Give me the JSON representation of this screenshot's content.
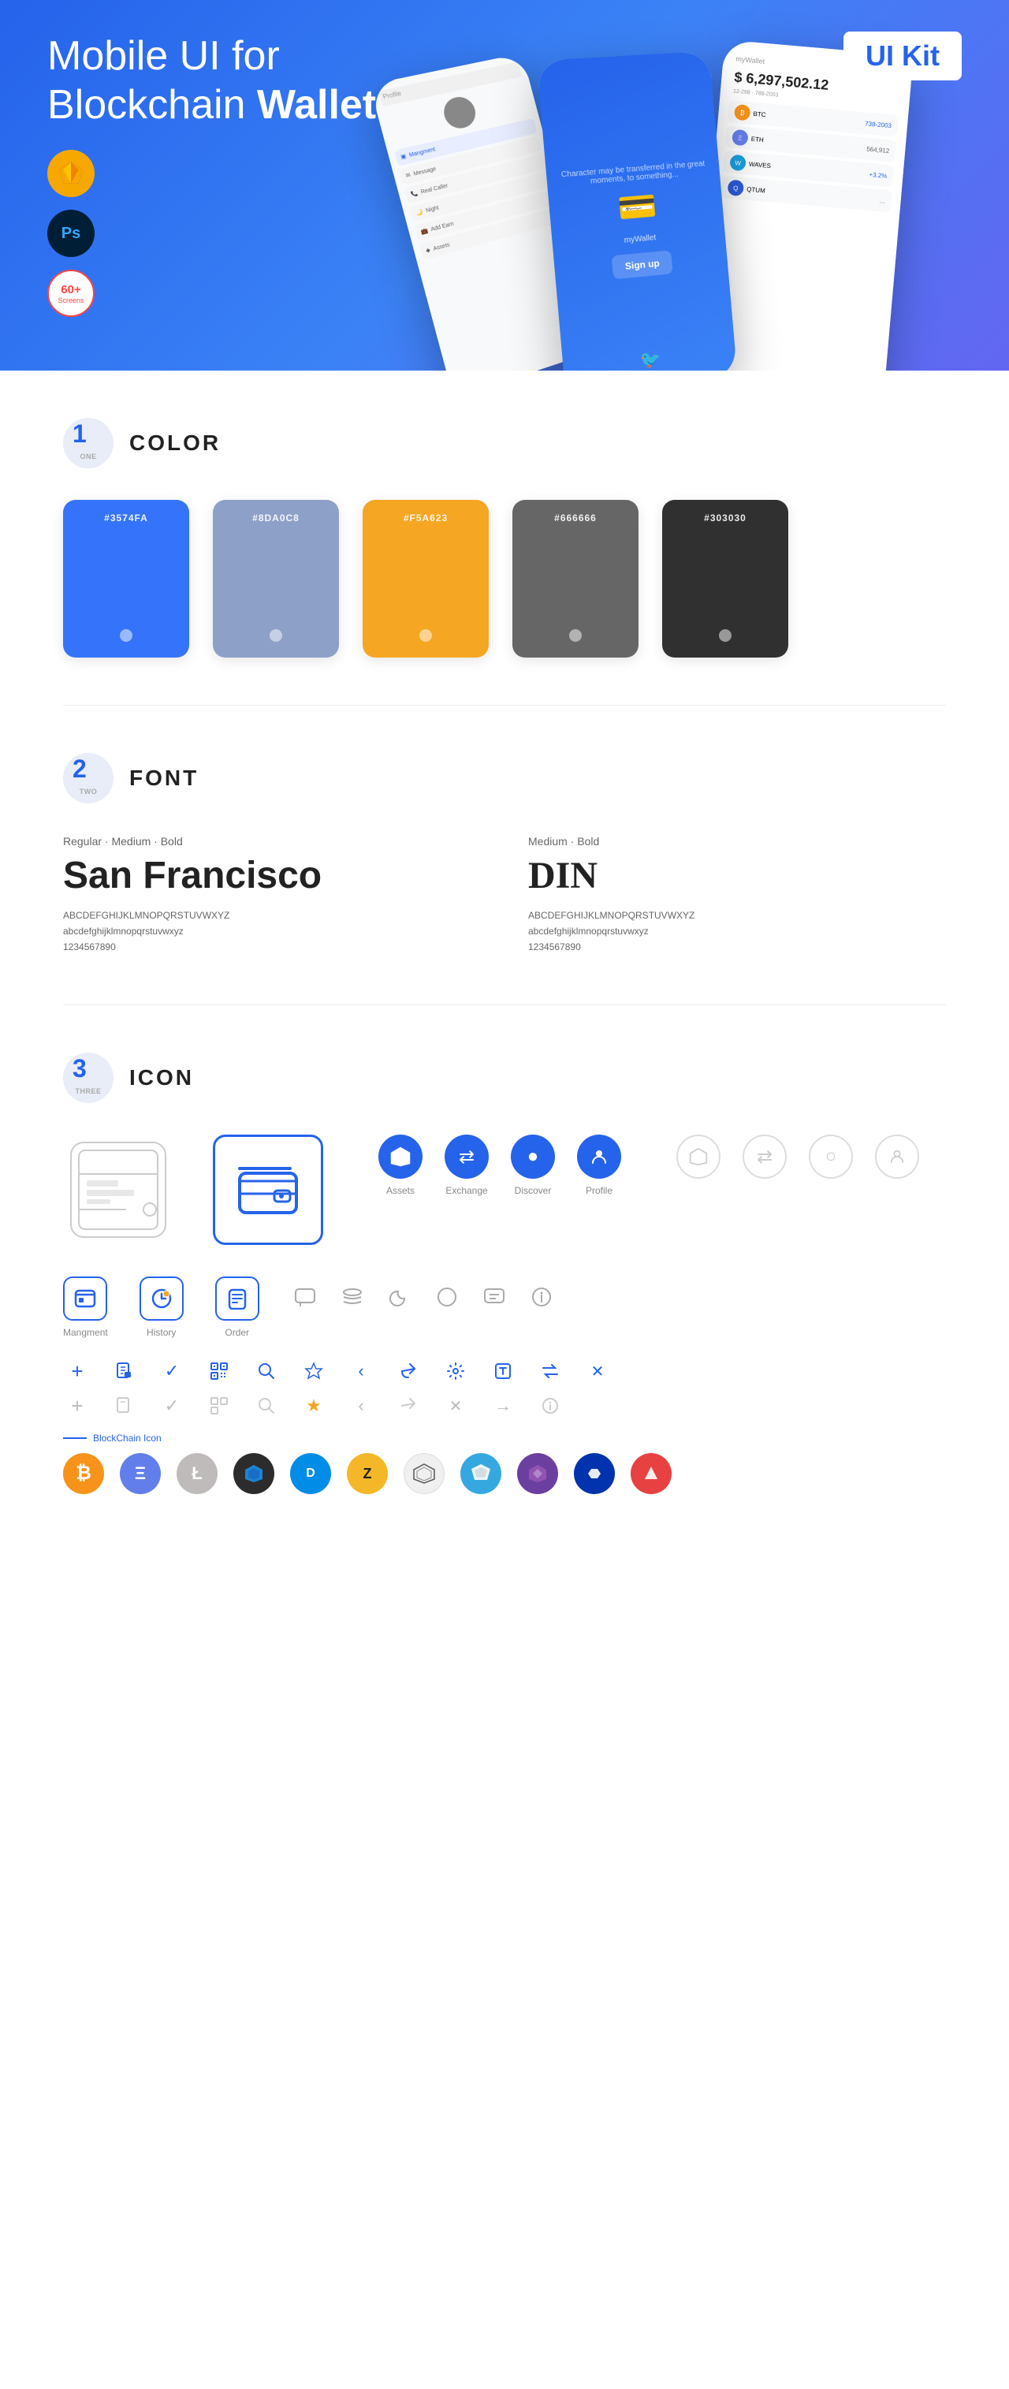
{
  "hero": {
    "title_regular": "Mobile UI for Blockchain ",
    "title_bold": "Wallet",
    "badge": "UI Kit",
    "badge_sketch": "Sketch",
    "badge_ps": "Ps",
    "badge_screens": "60+",
    "badge_screens_sub": "Screens"
  },
  "sections": {
    "color": {
      "number": "1",
      "word": "ONE",
      "title": "COLOR",
      "swatches": [
        {
          "hex": "#3574FA",
          "label": "#3574FA",
          "bg": "#3574FA"
        },
        {
          "hex": "#8DA0C8",
          "label": "#8DA0C8",
          "bg": "#8DA0C8"
        },
        {
          "hex": "#F5A623",
          "label": "#F5A623",
          "bg": "#F5A623"
        },
        {
          "hex": "#666666",
          "label": "#666666",
          "bg": "#666666"
        },
        {
          "hex": "#303030",
          "label": "#303030",
          "bg": "#303030"
        }
      ]
    },
    "font": {
      "number": "2",
      "word": "TWO",
      "title": "FONT",
      "font1": {
        "style": "Regular · Medium · Bold",
        "name": "San Francisco",
        "upper": "ABCDEFGHIJKLMNOPQRSTUVWXYZ",
        "lower": "abcdefghijklmnopqrstuvwxyz",
        "numbers": "1234567890"
      },
      "font2": {
        "style": "Medium · Bold",
        "name": "DIN",
        "upper": "ABCDEFGHIJKLMNOPQRSTUVWXYZ",
        "lower": "abcdefghijklmnopqrstuvwxyz",
        "numbers": "1234567890"
      }
    },
    "icon": {
      "number": "3",
      "word": "THREE",
      "title": "ICON",
      "nav_items": [
        {
          "label": "Assets",
          "icon": "◆"
        },
        {
          "label": "Exchange",
          "icon": "⇄"
        },
        {
          "label": "Discover",
          "icon": "●"
        },
        {
          "label": "Profile",
          "icon": "👤"
        }
      ],
      "bottom_items": [
        {
          "label": "Mangment",
          "icon": "▣"
        },
        {
          "label": "History",
          "icon": "🕐"
        },
        {
          "label": "Order",
          "icon": "≡"
        }
      ],
      "blockchain_label": "BlockChain Icon",
      "crypto_coins": [
        {
          "symbol": "₿",
          "bg": "#f7931a",
          "name": "Bitcoin"
        },
        {
          "symbol": "Ξ",
          "bg": "#627eea",
          "name": "Ethereum"
        },
        {
          "symbol": "Ł",
          "bg": "#bfbbbb",
          "name": "Litecoin"
        },
        {
          "symbol": "▲",
          "bg": "#2c2c2c",
          "name": "Cardano"
        },
        {
          "symbol": "D",
          "bg": "#008ce7",
          "name": "Dash"
        },
        {
          "symbol": "Z",
          "bg": "#f4b728",
          "name": "Zcash"
        },
        {
          "symbol": "◈",
          "bg": "#c0c0c0",
          "name": "Stellar"
        },
        {
          "symbol": "▲",
          "bg": "#35a8e0",
          "name": "Waves"
        },
        {
          "symbol": "◆",
          "bg": "#8b5cf6",
          "name": "Nano"
        },
        {
          "symbol": "⬡",
          "bg": "#0033ad",
          "name": "Polygon"
        },
        {
          "symbol": "◈",
          "bg": "#e84142",
          "name": "Avax"
        }
      ]
    }
  }
}
